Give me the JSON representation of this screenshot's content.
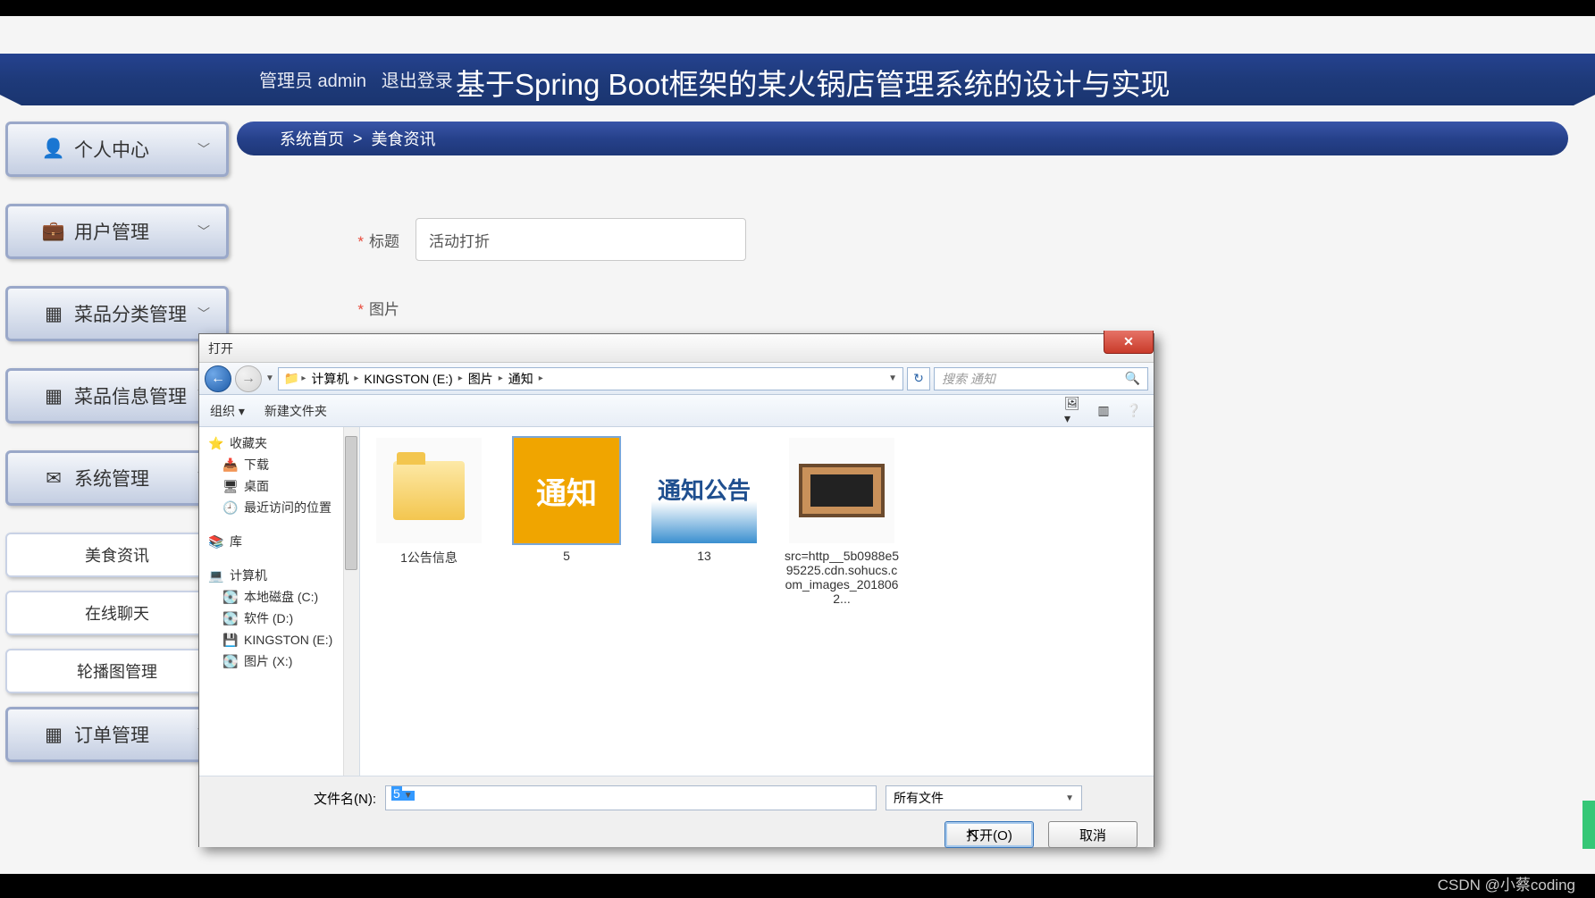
{
  "header": {
    "admin_label": "管理员 admin",
    "logout_label": "退出登录",
    "title": "基于Spring Boot框架的某火锅店管理系统的设计与实现"
  },
  "sidebar": {
    "items": [
      {
        "icon": "person",
        "label": "个人中心"
      },
      {
        "icon": "briefcase",
        "label": "用户管理"
      },
      {
        "icon": "grid",
        "label": "菜品分类管理"
      },
      {
        "icon": "grid",
        "label": "菜品信息管理"
      },
      {
        "icon": "mail",
        "label": "系统管理"
      }
    ],
    "sub_items": [
      {
        "label": "美食资讯"
      },
      {
        "label": "在线聊天"
      },
      {
        "label": "轮播图管理"
      }
    ],
    "order_item": {
      "icon": "grid",
      "label": "订单管理"
    }
  },
  "breadcrumb": {
    "home": "系统首页",
    "sep": ">",
    "current": "美食资讯"
  },
  "form": {
    "title_label": "标题",
    "title_value": "活动打折",
    "image_label": "图片"
  },
  "dialog": {
    "title": "打开",
    "path": [
      "计算机",
      "KINGSTON (E:)",
      "图片",
      "通知"
    ],
    "search_placeholder": "搜索 通知",
    "toolbar": {
      "organize": "组织 ▾",
      "newfolder": "新建文件夹"
    },
    "tree": {
      "favorites": "收藏夹",
      "downloads": "下载",
      "desktop": "桌面",
      "recent": "最近访问的位置",
      "library": "库",
      "computer": "计算机",
      "drive_c": "本地磁盘 (C:)",
      "drive_d": "软件 (D:)",
      "drive_e": "KINGSTON (E:)",
      "drive_x": "图片 (X:)"
    },
    "files": [
      {
        "name": "1公告信息",
        "kind": "folder"
      },
      {
        "name": "5",
        "kind": "img-yellow",
        "text": "通知"
      },
      {
        "name": "13",
        "kind": "img-blue",
        "text": "通知公告"
      },
      {
        "name": "src=http__5b0988e595225.cdn.sohucs.com_images_2018062...",
        "kind": "img-board"
      }
    ],
    "footer": {
      "filename_label": "文件名(N):",
      "filename_value": "5",
      "filetype": "所有文件",
      "open": "打开(O)",
      "cancel": "取消"
    }
  },
  "watermark": "CSDN @小蔡coding"
}
